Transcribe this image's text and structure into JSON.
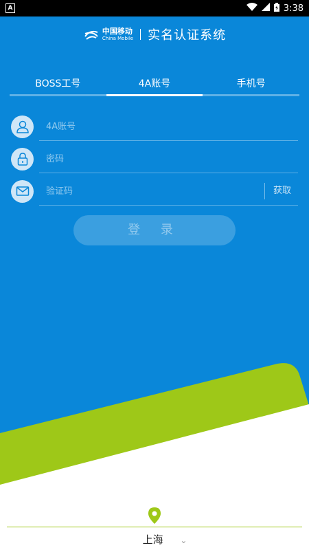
{
  "status_bar": {
    "notification_letter": "A",
    "time": "3:38"
  },
  "header": {
    "brand_cn": "中国移动",
    "brand_en": "China Mobile",
    "system_title": "实名认证系统"
  },
  "tabs": [
    {
      "label": "BOSS工号",
      "active": false
    },
    {
      "label": "4A账号",
      "active": true
    },
    {
      "label": "手机号",
      "active": false
    }
  ],
  "form": {
    "account_placeholder": "4A账号",
    "password_placeholder": "密码",
    "code_placeholder": "验证码",
    "get_code_label": "获取",
    "login_label": "登 录"
  },
  "location": {
    "city": "上海"
  },
  "colors": {
    "primary_blue": "#0a87d9",
    "accent_green": "#9ec818"
  }
}
